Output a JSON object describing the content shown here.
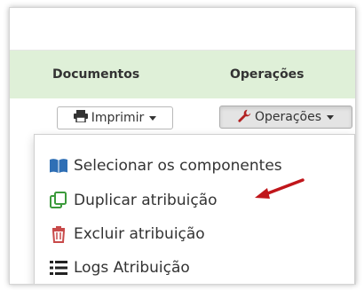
{
  "table": {
    "headers": [
      "Documentos",
      "Operações"
    ]
  },
  "buttons": {
    "print_label": "Imprimir",
    "ops_label": "Operações"
  },
  "menu": {
    "items": [
      {
        "label": "Selecionar os componentes",
        "icon": "book-icon",
        "color": "#2f6fb5"
      },
      {
        "label": "Duplicar atribuição",
        "icon": "copy-icon",
        "color": "#3b9a3b"
      },
      {
        "label": "Excluir atribuição",
        "icon": "trash-icon",
        "color": "#c84a4a"
      },
      {
        "label": "Logs Atribuição",
        "icon": "list-icon",
        "color": "#333333"
      }
    ]
  },
  "colors": {
    "header_bg": "#dff0d8",
    "annotation_arrow": "#c0161b"
  }
}
